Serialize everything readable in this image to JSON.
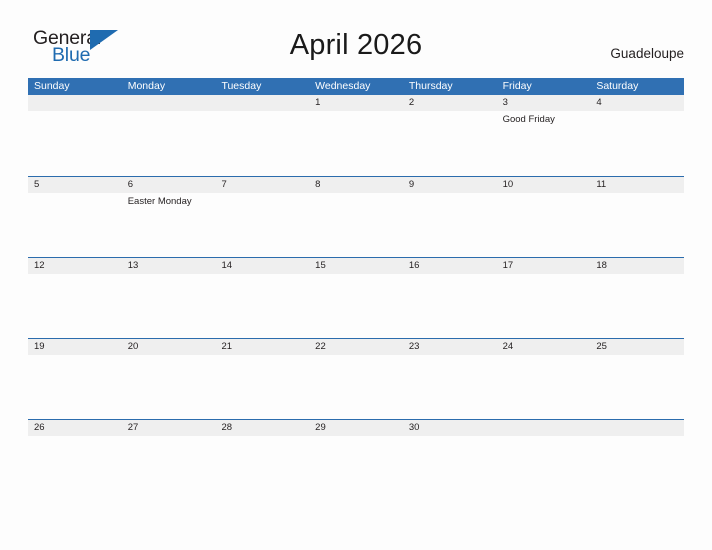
{
  "brand": {
    "name_part1": "General",
    "name_part2": "Blue",
    "flag_icon": "triangle-flag-icon",
    "accent_color": "#1f6bb0"
  },
  "header": {
    "title": "April 2026",
    "location": "Guadeloupe"
  },
  "theme": {
    "header_blue": "#3070b3",
    "row_divider_blue": "#2b6cad",
    "day_band_gray": "#efefef",
    "page_background": "#fdfdfd",
    "text_color": "#231f20"
  },
  "calendar": {
    "month": "April",
    "year": "2026",
    "weekdays": [
      "Sunday",
      "Monday",
      "Tuesday",
      "Wednesday",
      "Thursday",
      "Friday",
      "Saturday"
    ],
    "weeks": [
      [
        {
          "day": "",
          "events": []
        },
        {
          "day": "",
          "events": []
        },
        {
          "day": "",
          "events": []
        },
        {
          "day": "1",
          "events": []
        },
        {
          "day": "2",
          "events": []
        },
        {
          "day": "3",
          "events": [
            "Good Friday"
          ]
        },
        {
          "day": "4",
          "events": []
        }
      ],
      [
        {
          "day": "5",
          "events": []
        },
        {
          "day": "6",
          "events": [
            "Easter Monday"
          ]
        },
        {
          "day": "7",
          "events": []
        },
        {
          "day": "8",
          "events": []
        },
        {
          "day": "9",
          "events": []
        },
        {
          "day": "10",
          "events": []
        },
        {
          "day": "11",
          "events": []
        }
      ],
      [
        {
          "day": "12",
          "events": []
        },
        {
          "day": "13",
          "events": []
        },
        {
          "day": "14",
          "events": []
        },
        {
          "day": "15",
          "events": []
        },
        {
          "day": "16",
          "events": []
        },
        {
          "day": "17",
          "events": []
        },
        {
          "day": "18",
          "events": []
        }
      ],
      [
        {
          "day": "19",
          "events": []
        },
        {
          "day": "20",
          "events": []
        },
        {
          "day": "21",
          "events": []
        },
        {
          "day": "22",
          "events": []
        },
        {
          "day": "23",
          "events": []
        },
        {
          "day": "24",
          "events": []
        },
        {
          "day": "25",
          "events": []
        }
      ],
      [
        {
          "day": "26",
          "events": []
        },
        {
          "day": "27",
          "events": []
        },
        {
          "day": "28",
          "events": []
        },
        {
          "day": "29",
          "events": []
        },
        {
          "day": "30",
          "events": []
        },
        {
          "day": "",
          "events": []
        },
        {
          "day": "",
          "events": []
        }
      ]
    ]
  }
}
